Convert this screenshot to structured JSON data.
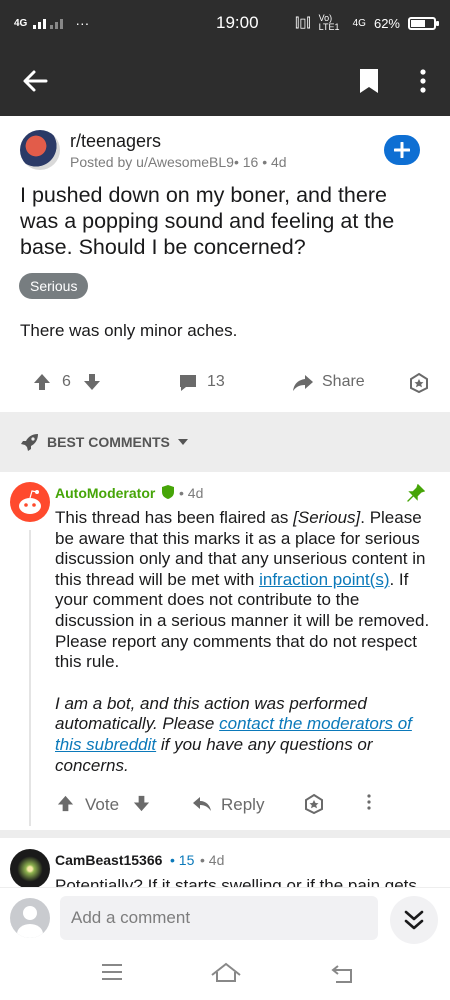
{
  "status_bar": {
    "network_left": "4G",
    "time": "19:00",
    "volte": "Vo) LTE1",
    "network_right": "4G",
    "battery_pct": "62%",
    "battery_level": 0.62
  },
  "app_bar": {
    "back_icon": "arrow-left-icon",
    "save_icon": "bookmark-icon",
    "more_icon": "more-vertical-icon"
  },
  "post": {
    "subreddit": "r/teenagers",
    "posted_by": "Posted by u/AwesomeBL9",
    "age_badge": "• 16",
    "time": "• 4d",
    "title": "I pushed down on my boner, and there was a popping sound and feeling at the base. Should I be concerned?",
    "flair": "Serious",
    "body": "There was only minor aches.",
    "votes": "6",
    "comments": "13",
    "share_label": "Share"
  },
  "sort": {
    "label": "BEST COMMENTS"
  },
  "comments": [
    {
      "author": "AutoModerator",
      "time": "• 4d",
      "body_p1_a": "This thread has been flaired as ",
      "body_p1_em": "[Serious]",
      "body_p1_b": ". Please be aware that this marks it as a place for serious discussion only and that any unserious content in this thread will be met with ",
      "body_p1_link": "infraction point(s)",
      "body_p1_c": ". If your comment does not contribute to the discussion in a serious manner it will be removed. Please report any comments that do not respect this rule.",
      "body_p2_a": "I am a bot, and this action was performed automatically. Please ",
      "body_p2_link": "contact the moderators of this subreddit",
      "body_p2_b": " if you have any questions or concerns.",
      "vote_label": "Vote",
      "reply_label": "Reply"
    },
    {
      "author": "CamBeast15366",
      "age_badge": "• 15",
      "time": "• 4d",
      "body": "Potentially? If it starts swelling or if the pain gets"
    }
  ],
  "comment_bar": {
    "placeholder": "Add a comment"
  },
  "colors": {
    "dark_bar": "#2d2d2d",
    "accent_blue": "#0e6fd3",
    "mod_green": "#46a508",
    "link_blue": "#0b79ba"
  }
}
